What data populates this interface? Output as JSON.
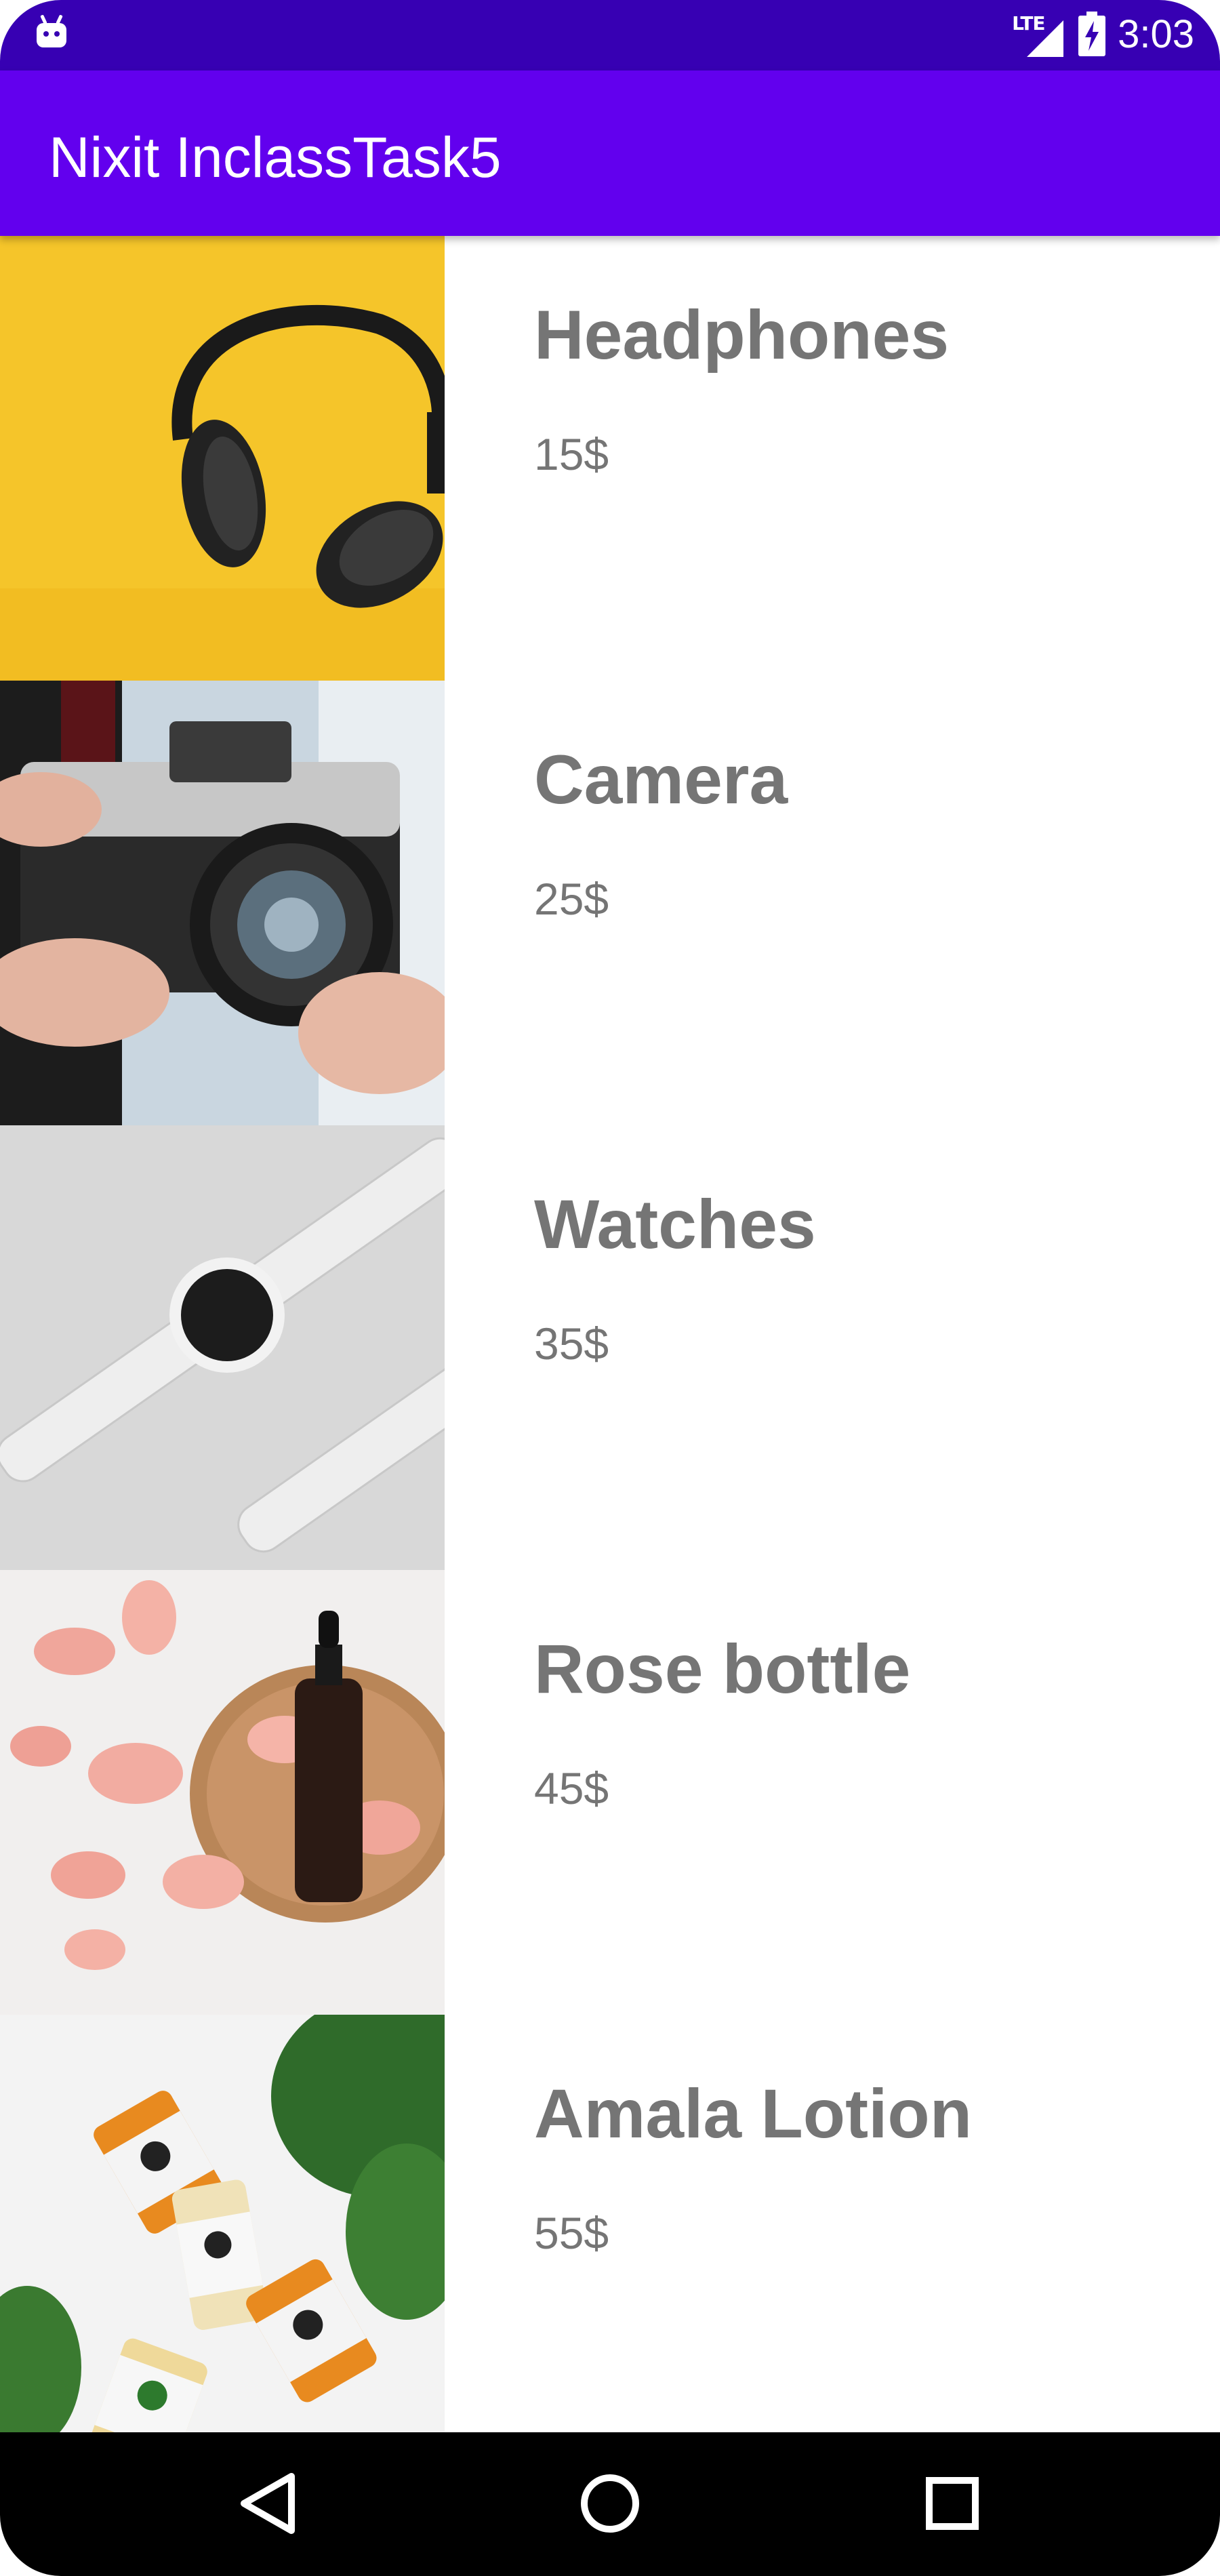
{
  "status_bar": {
    "network": "LTE",
    "time": "3:03"
  },
  "app_bar": {
    "title": "Nixit InclassTask5"
  },
  "products": [
    {
      "name": "Headphones",
      "price": "15$",
      "image": "headphones-photo"
    },
    {
      "name": "Camera",
      "price": "25$",
      "image": "camera-photo"
    },
    {
      "name": "Watches",
      "price": "35$",
      "image": "watches-photo"
    },
    {
      "name": "Rose bottle",
      "price": "45$",
      "image": "rose-bottle-photo"
    },
    {
      "name": "Amala Lotion",
      "price": "55$",
      "image": "lotion-photo"
    }
  ],
  "nav_bar": {
    "buttons": [
      "back-icon",
      "home-icon",
      "recents-icon"
    ]
  },
  "colors": {
    "status_bar": "#3700b3",
    "app_bar": "#6200ee",
    "text_gray": "#757575"
  }
}
